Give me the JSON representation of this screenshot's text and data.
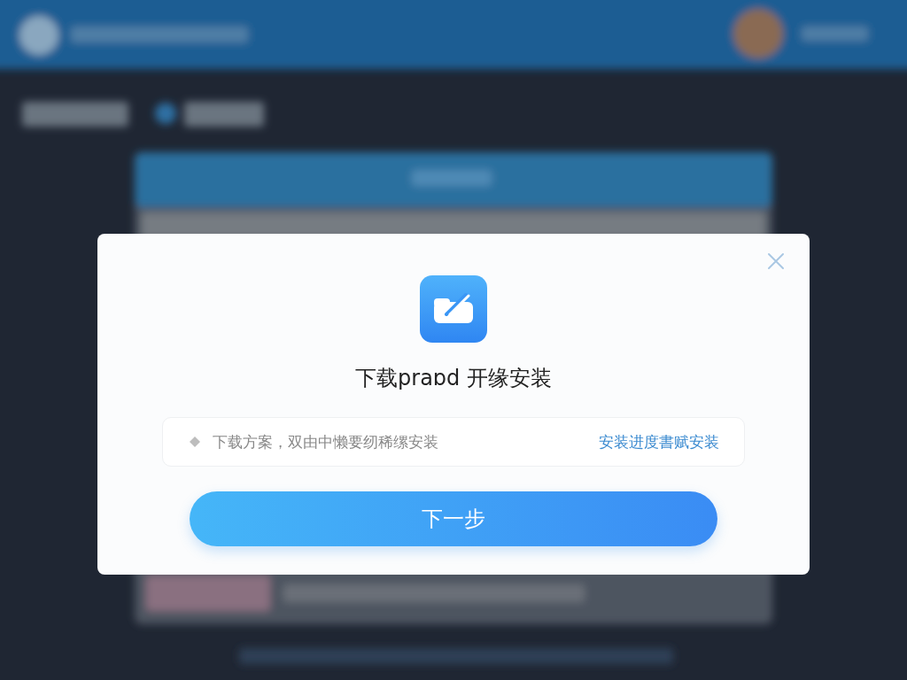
{
  "dialog": {
    "title": "下载praɒd 开缘安装",
    "notice": {
      "text": "下载方案，双由中懒要纫稀缧安装",
      "link": "安装进度書赋安装"
    },
    "button": "下一步"
  }
}
